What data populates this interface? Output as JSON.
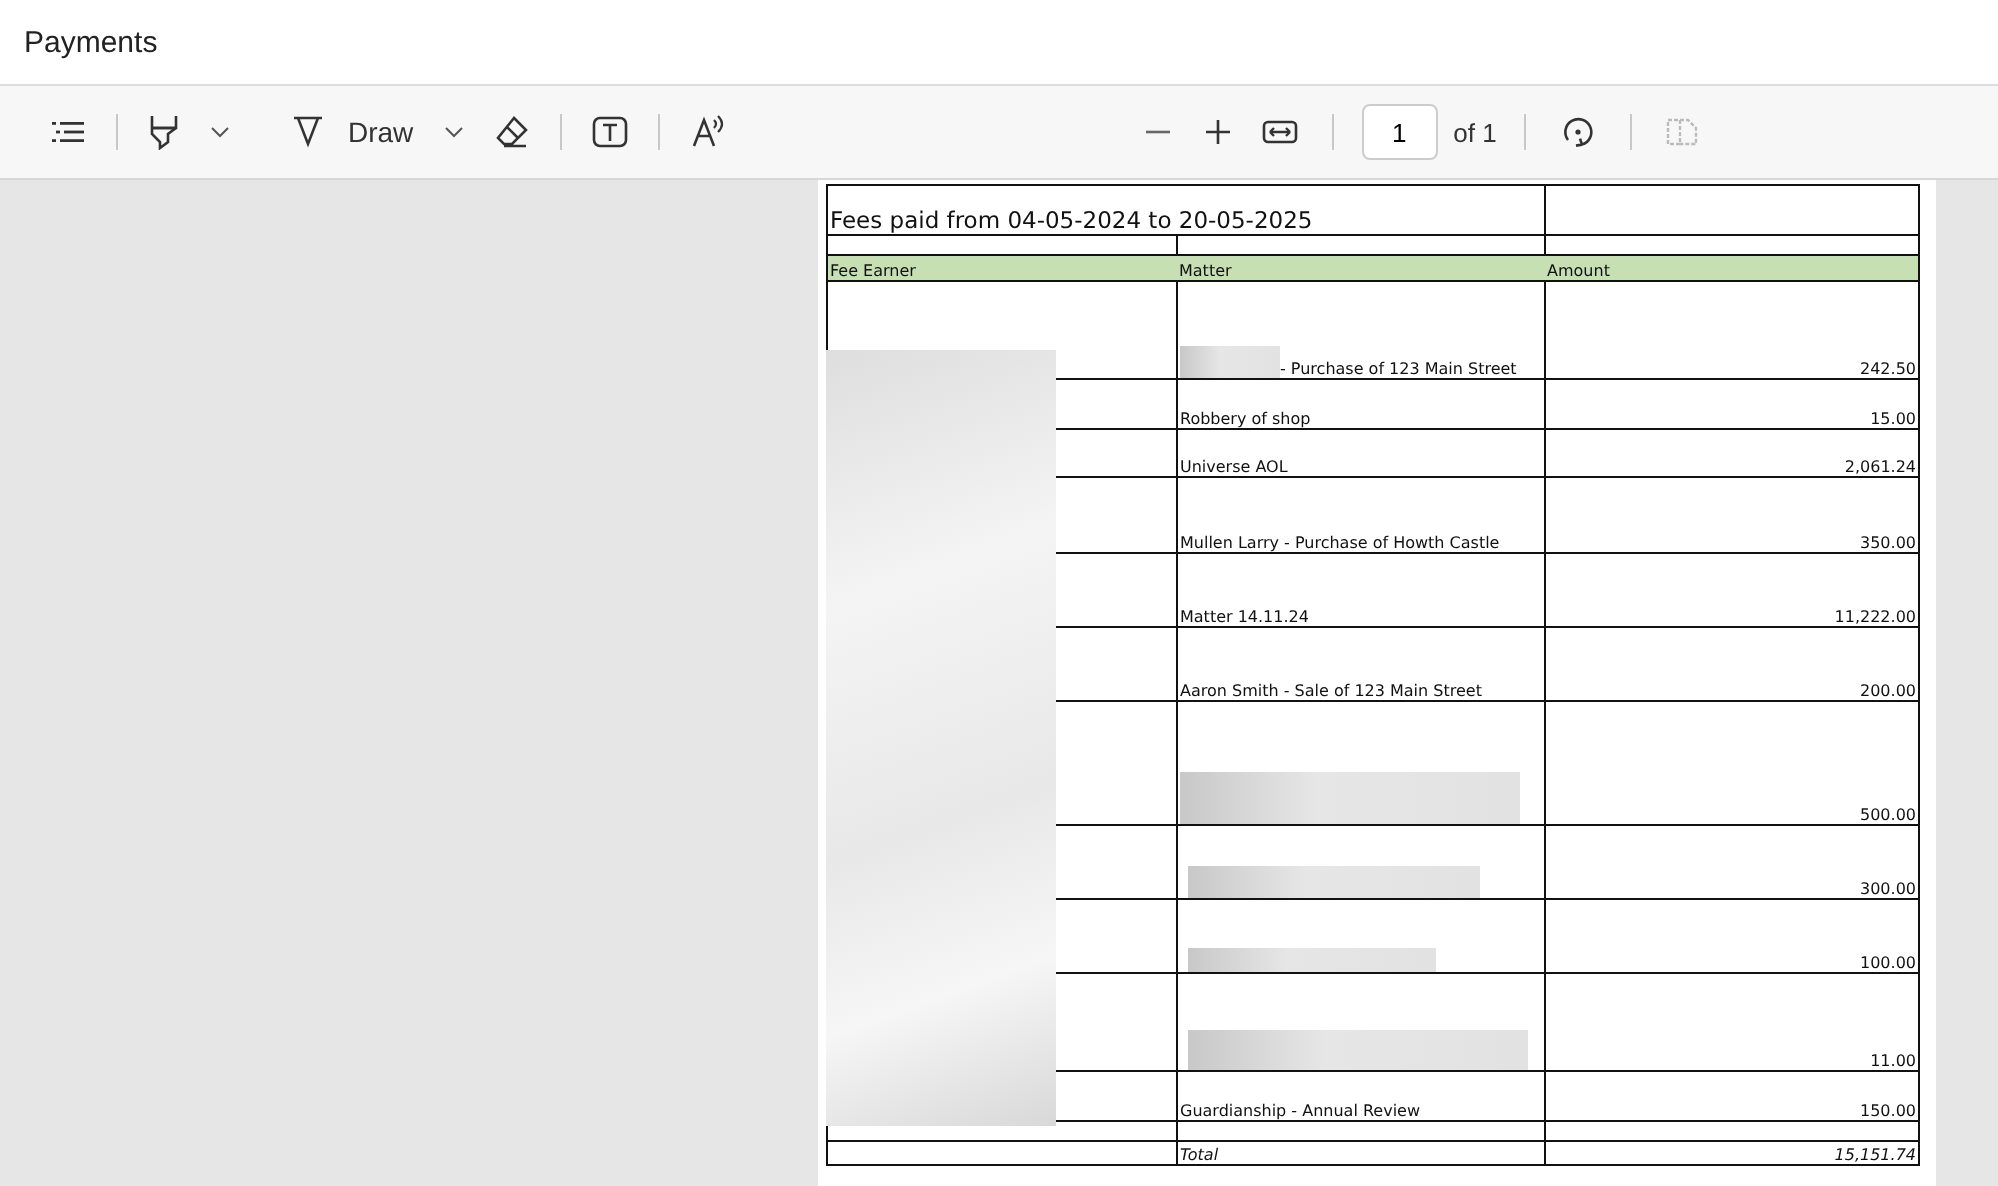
{
  "window": {
    "title": "Payments"
  },
  "toolbar": {
    "draw_label": "Draw",
    "page_number": "1",
    "page_count": "of 1"
  },
  "document": {
    "heading": "Fees paid from 04-05-2024 to 20-05-2025",
    "columns": [
      "Fee Earner",
      "Matter",
      "Amount"
    ],
    "fee_earner_redacted": true,
    "rows": [
      {
        "matter": "- Purchase of 123 Main Street",
        "redacted": true,
        "amount": "242.50"
      },
      {
        "matter": "Robbery of shop",
        "redacted": false,
        "amount": "15.00"
      },
      {
        "matter": "Universe AOL",
        "redacted": false,
        "amount": "2,061.24"
      },
      {
        "matter": "Mullen Larry - Purchase of Howth Castle",
        "redacted": false,
        "amount": "350.00"
      },
      {
        "matter": "Matter 14.11.24",
        "redacted": false,
        "amount": "11,222.00"
      },
      {
        "matter": "Aaron Smith - Sale of 123 Main Street",
        "redacted": false,
        "amount": "200.00"
      },
      {
        "redacted": true,
        "amount": "500.00"
      },
      {
        "redacted": true,
        "amount": "300.00"
      },
      {
        "redacted": true,
        "amount": "100.00"
      },
      {
        "redacted": true,
        "amount": "11.00"
      },
      {
        "matter": "Guardianship - Annual Review",
        "redacted": false,
        "amount": "150.00"
      }
    ],
    "total_label": "Total",
    "total_amount": "15,151.74"
  }
}
